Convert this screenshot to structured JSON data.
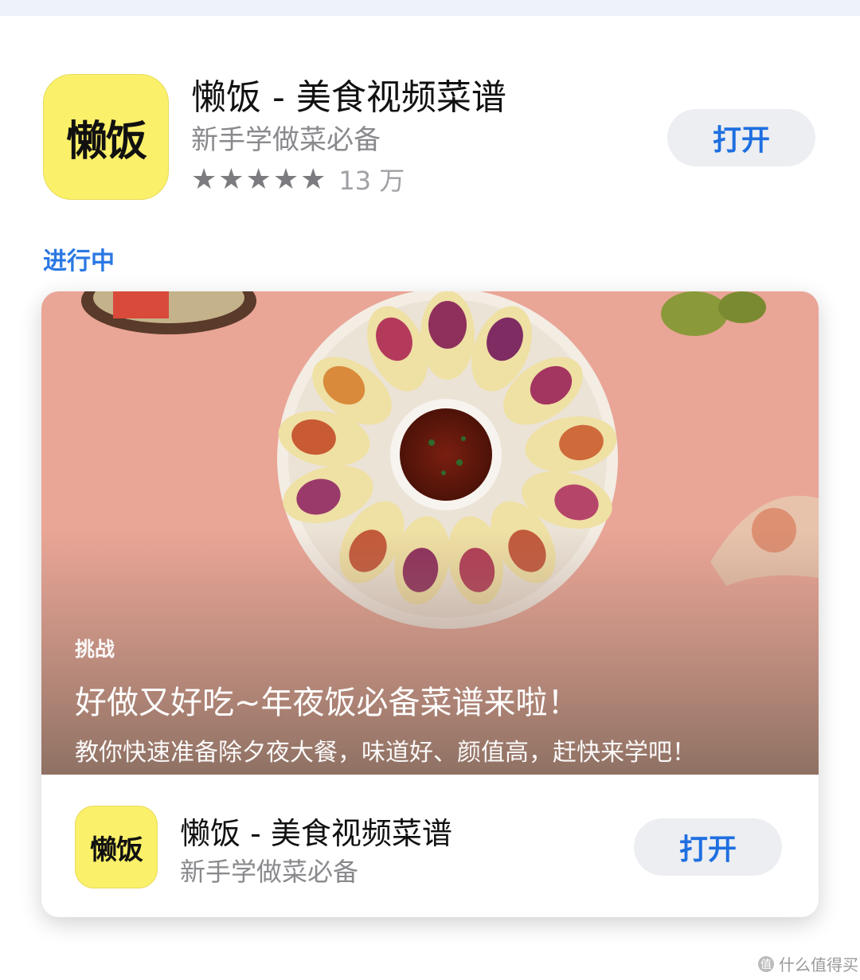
{
  "app": {
    "icon_text": "懒饭",
    "title": "懒饭 - 美食视频菜谱",
    "subtitle": "新手学做菜必备",
    "rating_stars": "★★★★★",
    "rating_count": "13 万",
    "open_button": "打开"
  },
  "section": {
    "label": "进行中"
  },
  "event_card": {
    "tag": "挑战",
    "title": "好做又好吃~年夜饭必备菜谱来啦！",
    "description": "教你快速准备除夕夜大餐，味道好、颜值高，赶快来学吧！",
    "app_icon_text": "懒饭",
    "app_title": "懒饭 - 美食视频菜谱",
    "app_subtitle": "新手学做菜必备",
    "open_button": "打开"
  },
  "watermark": {
    "icon": "值",
    "text": "什么值得买"
  },
  "colors": {
    "accent": "#1f6fe0",
    "icon_yellow": "#fbf06a",
    "hero_bg": "#e9a596",
    "button_bg": "#eceef2"
  }
}
